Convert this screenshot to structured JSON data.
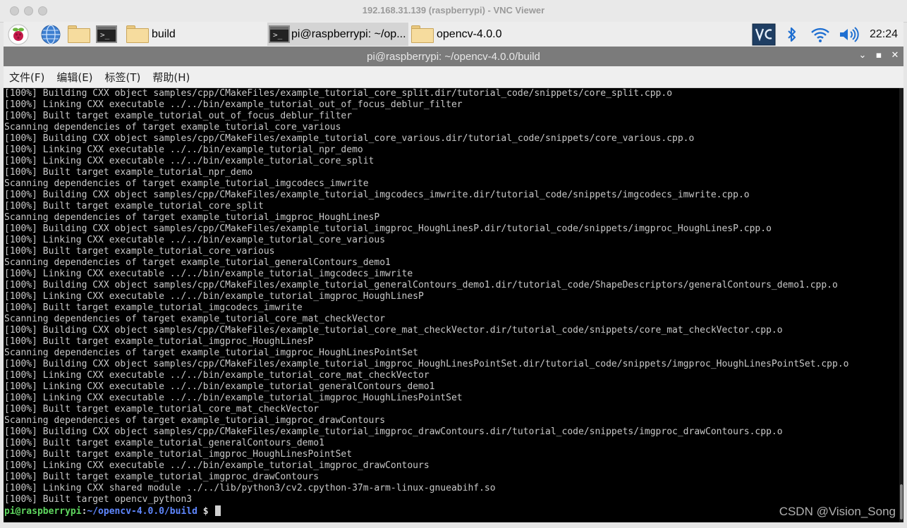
{
  "vnc": {
    "title": "192.168.31.139 (raspberrypi) - VNC Viewer"
  },
  "panel": {
    "tasks": [
      {
        "label": "build"
      },
      {
        "label": "pi@raspberrypi: ~/op..."
      },
      {
        "label": "opencv-4.0.0"
      }
    ],
    "clock": "22:24"
  },
  "window": {
    "title": "pi@raspberrypi: ~/opencv-4.0.0/build",
    "controls": {
      "minimize": "⌄",
      "maximize": "▪",
      "close": "✕"
    }
  },
  "menubar": {
    "items": [
      "文件(F)",
      "编辑(E)",
      "标签(T)",
      "帮助(H)"
    ]
  },
  "terminal": {
    "lines": [
      "[100%] Building CXX object samples/cpp/CMakeFiles/example_tutorial_core_split.dir/tutorial_code/snippets/core_split.cpp.o",
      "[100%] Linking CXX executable ../../bin/example_tutorial_out_of_focus_deblur_filter",
      "[100%] Built target example_tutorial_out_of_focus_deblur_filter",
      "Scanning dependencies of target example_tutorial_core_various",
      "[100%] Building CXX object samples/cpp/CMakeFiles/example_tutorial_core_various.dir/tutorial_code/snippets/core_various.cpp.o",
      "[100%] Linking CXX executable ../../bin/example_tutorial_npr_demo",
      "[100%] Linking CXX executable ../../bin/example_tutorial_core_split",
      "[100%] Built target example_tutorial_npr_demo",
      "Scanning dependencies of target example_tutorial_imgcodecs_imwrite",
      "[100%] Building CXX object samples/cpp/CMakeFiles/example_tutorial_imgcodecs_imwrite.dir/tutorial_code/snippets/imgcodecs_imwrite.cpp.o",
      "[100%] Built target example_tutorial_core_split",
      "Scanning dependencies of target example_tutorial_imgproc_HoughLinesP",
      "[100%] Building CXX object samples/cpp/CMakeFiles/example_tutorial_imgproc_HoughLinesP.dir/tutorial_code/snippets/imgproc_HoughLinesP.cpp.o",
      "[100%] Linking CXX executable ../../bin/example_tutorial_core_various",
      "[100%] Built target example_tutorial_core_various",
      "Scanning dependencies of target example_tutorial_generalContours_demo1",
      "[100%] Linking CXX executable ../../bin/example_tutorial_imgcodecs_imwrite",
      "[100%] Building CXX object samples/cpp/CMakeFiles/example_tutorial_generalContours_demo1.dir/tutorial_code/ShapeDescriptors/generalContours_demo1.cpp.o",
      "[100%] Linking CXX executable ../../bin/example_tutorial_imgproc_HoughLinesP",
      "[100%] Built target example_tutorial_imgcodecs_imwrite",
      "Scanning dependencies of target example_tutorial_core_mat_checkVector",
      "[100%] Building CXX object samples/cpp/CMakeFiles/example_tutorial_core_mat_checkVector.dir/tutorial_code/snippets/core_mat_checkVector.cpp.o",
      "[100%] Built target example_tutorial_imgproc_HoughLinesP",
      "Scanning dependencies of target example_tutorial_imgproc_HoughLinesPointSet",
      "[100%] Building CXX object samples/cpp/CMakeFiles/example_tutorial_imgproc_HoughLinesPointSet.dir/tutorial_code/snippets/imgproc_HoughLinesPointSet.cpp.o",
      "[100%] Linking CXX executable ../../bin/example_tutorial_core_mat_checkVector",
      "[100%] Linking CXX executable ../../bin/example_tutorial_generalContours_demo1",
      "[100%] Linking CXX executable ../../bin/example_tutorial_imgproc_HoughLinesPointSet",
      "[100%] Built target example_tutorial_core_mat_checkVector",
      "Scanning dependencies of target example_tutorial_imgproc_drawContours",
      "[100%] Building CXX object samples/cpp/CMakeFiles/example_tutorial_imgproc_drawContours.dir/tutorial_code/snippets/imgproc_drawContours.cpp.o",
      "[100%] Built target example_tutorial_generalContours_demo1",
      "[100%] Built target example_tutorial_imgproc_HoughLinesPointSet",
      "[100%] Linking CXX executable ../../bin/example_tutorial_imgproc_drawContours",
      "[100%] Built target example_tutorial_imgproc_drawContours",
      "[100%] Linking CXX shared module ../../lib/python3/cv2.cpython-37m-arm-linux-gnueabihf.so",
      "[100%] Built target opencv_python3"
    ],
    "prompt": {
      "user": "pi@raspberrypi",
      "sep": ":",
      "path": "~/opencv-4.0.0/build",
      "symbol": " $ "
    }
  },
  "watermark": "CSDN @Vision_Song"
}
